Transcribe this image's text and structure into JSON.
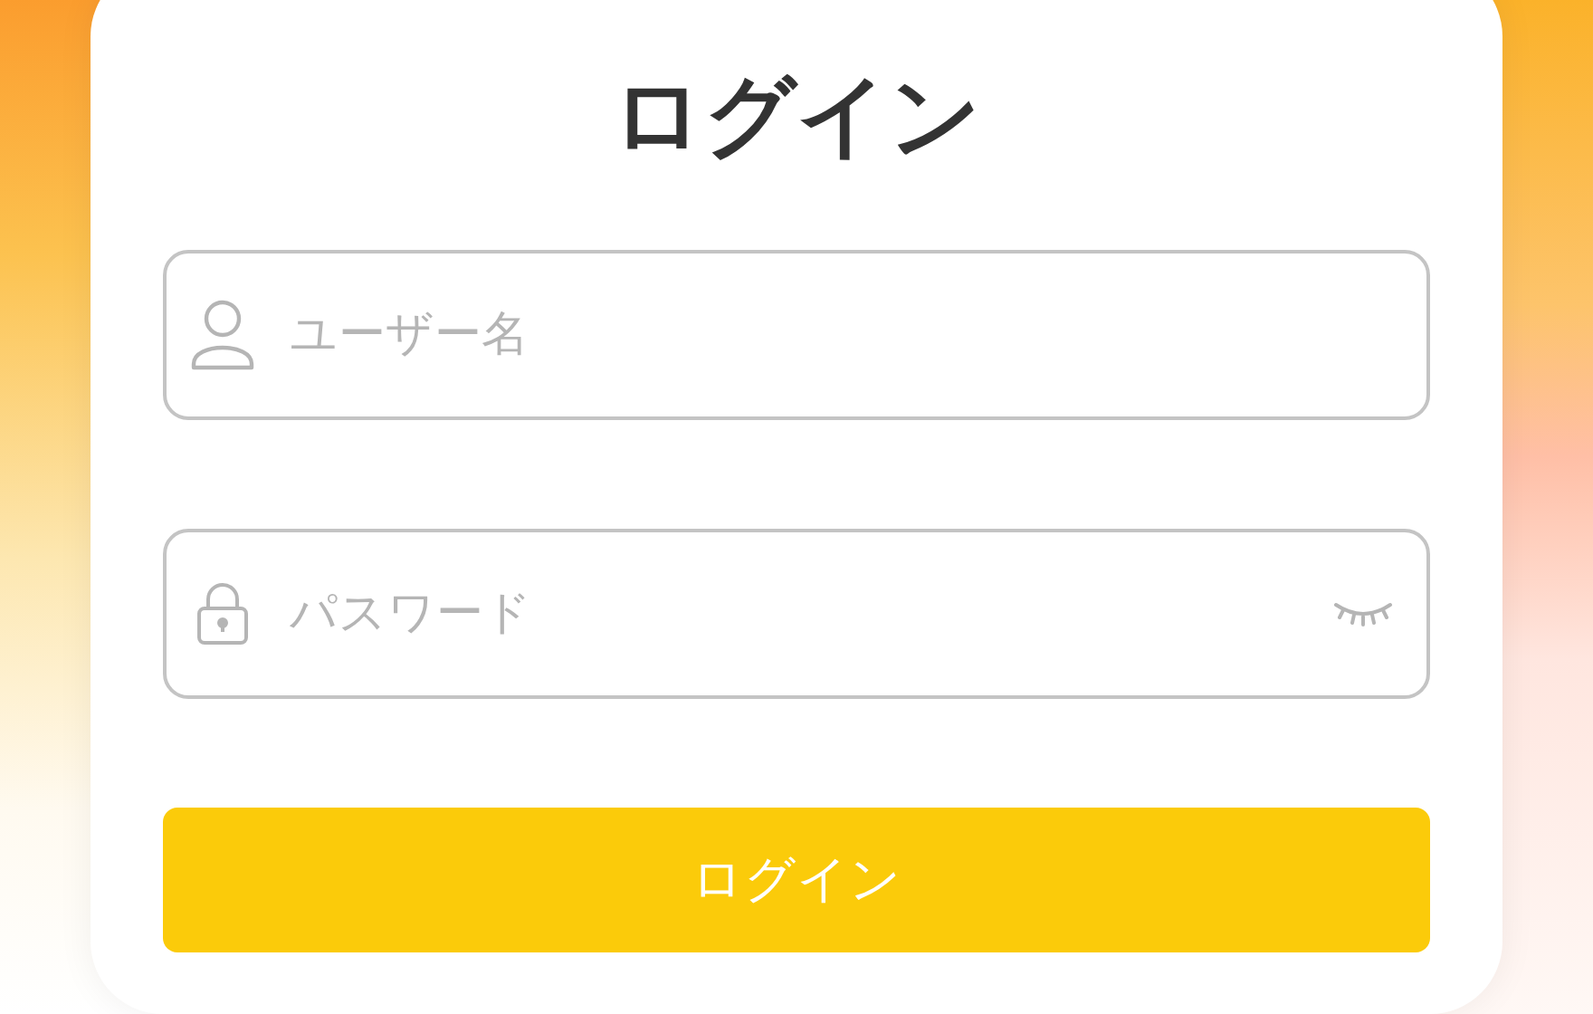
{
  "title": "ログイン",
  "fields": [
    {
      "kind": "username",
      "placeholder": "ユーザー名"
    },
    {
      "kind": "password",
      "placeholder": "パスワード"
    }
  ],
  "button": "ログイン"
}
